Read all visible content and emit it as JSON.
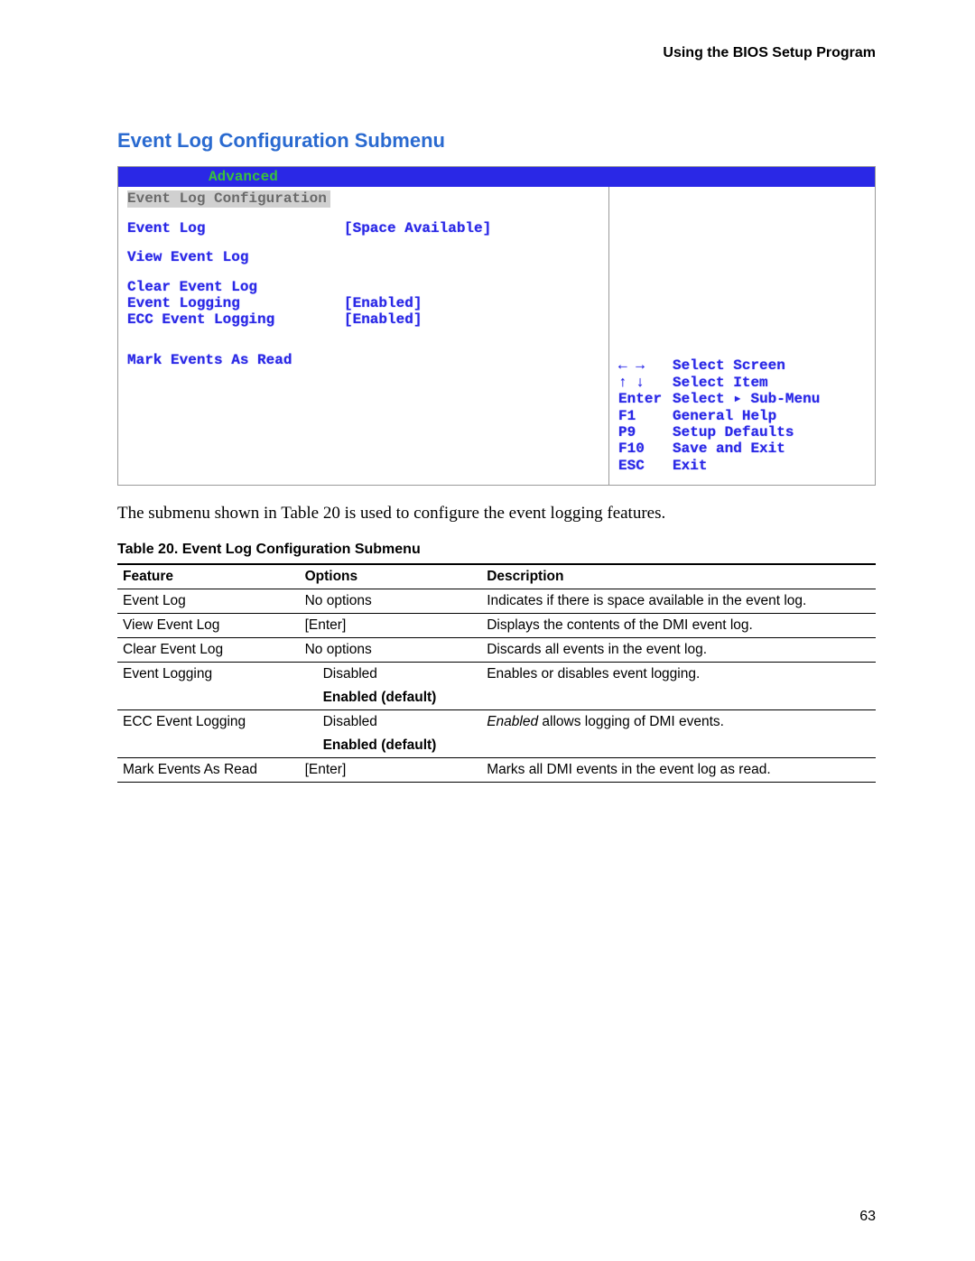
{
  "running_head": "Using the BIOS Setup Program",
  "section_title": "Event Log Configuration Submenu",
  "bios": {
    "menu_tab": "Advanced",
    "screen_title": "Event Log Configuration",
    "rows": [
      {
        "label": "Event Log",
        "value": "[Space Available]"
      },
      {
        "label": "View Event Log",
        "value": ""
      },
      {
        "label": "Clear Event Log",
        "value": ""
      },
      {
        "label": "Event Logging",
        "value": "[Enabled]"
      },
      {
        "label": "ECC Event Logging",
        "value": "[Enabled]"
      },
      {
        "label": "Mark Events As Read",
        "value": ""
      }
    ],
    "help": [
      {
        "key": "← →",
        "text": "Select Screen"
      },
      {
        "key": "↑ ↓",
        "text": "Select Item"
      },
      {
        "key": "Enter",
        "text": "Select ▸ Sub-Menu"
      },
      {
        "key": "F1",
        "text": "General Help"
      },
      {
        "key": "P9",
        "text": "Setup Defaults"
      },
      {
        "key": "F10",
        "text": "Save and Exit"
      },
      {
        "key": "ESC",
        "text": "Exit"
      }
    ]
  },
  "body_text": "The submenu shown in Table 20 is used to configure the event logging features.",
  "table_caption": "Table 20.    Event Log Configuration Submenu",
  "table": {
    "headers": {
      "feature": "Feature",
      "options": "Options",
      "description": "Description"
    },
    "rows": [
      {
        "feature": "Event Log",
        "opt1": "No options",
        "opt2": "",
        "desc": "Indicates if there is space available in the event log."
      },
      {
        "feature": "View Event Log",
        "opt1": "[Enter]",
        "opt2": "",
        "desc": "Displays the contents of the DMI event log."
      },
      {
        "feature": "Clear Event Log",
        "opt1": "No options",
        "opt2": "",
        "desc": "Discards all events in the event log."
      },
      {
        "feature": "Event Logging",
        "opt1": "Disabled",
        "opt2": "Enabled (default)",
        "desc": "Enables or disables event logging."
      },
      {
        "feature": "ECC Event Logging",
        "opt1": "Disabled",
        "opt2": "Enabled (default)",
        "desc_pre": "Enabled",
        "desc_post": " allows logging of DMI events."
      },
      {
        "feature": "Mark Events As Read",
        "opt1": "[Enter]",
        "opt2": "",
        "desc": "Marks all DMI events in the event log as read."
      }
    ]
  },
  "page_number": "63"
}
